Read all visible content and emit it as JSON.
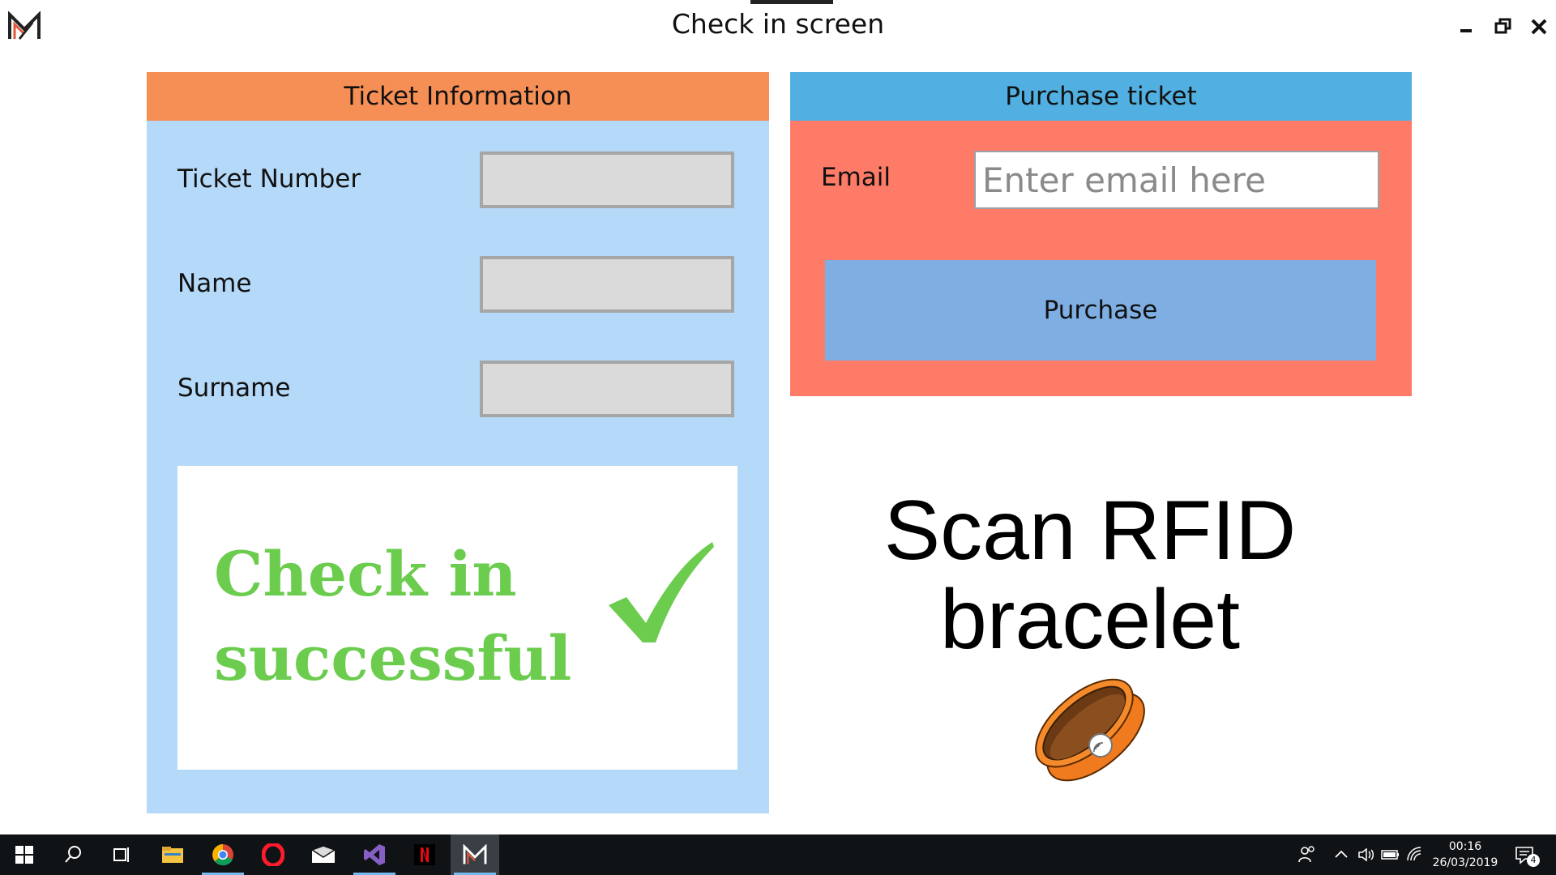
{
  "window": {
    "title": "Check in screen"
  },
  "ticket_panel": {
    "header": "Ticket Information",
    "fields": [
      {
        "label": "Ticket Number",
        "value": ""
      },
      {
        "label": "Name",
        "value": ""
      },
      {
        "label": "Surname",
        "value": ""
      }
    ],
    "status_line1": "Check in",
    "status_line2": "successful",
    "status_color": "#6bcc4e"
  },
  "purchase_panel": {
    "header": "Purchase ticket",
    "email_label": "Email",
    "email_placeholder": "Enter email here",
    "email_value": "",
    "button_label": "Purchase"
  },
  "scan": {
    "line1": "Scan RFID",
    "line2": "bracelet",
    "icon": "rfid-bracelet-icon"
  },
  "colors": {
    "ticket_header": "#f68f55",
    "ticket_body": "#b5d9f8",
    "purchase_header": "#51b0e1",
    "purchase_body": "#fe7b67",
    "purchase_button": "#7eaee2"
  },
  "taskbar": {
    "apps": [
      "windows-start-icon",
      "search-icon",
      "task-view-icon",
      "file-explorer-icon",
      "chrome-icon",
      "opera-icon",
      "mail-icon",
      "visual-studio-icon",
      "netflix-icon",
      "check-in-app-icon"
    ],
    "tray_icons": [
      "people-icon",
      "chevron-up-icon",
      "volume-icon",
      "battery-icon",
      "wifi-icon",
      "notification-icon"
    ],
    "time": "00:16",
    "date": "26/03/2019",
    "notification_count": "4"
  }
}
